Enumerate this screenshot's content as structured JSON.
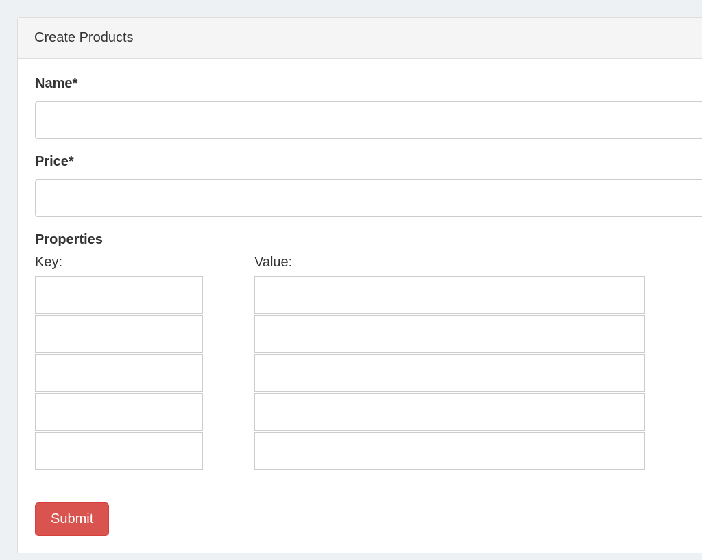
{
  "panel": {
    "title": "Create Products"
  },
  "form": {
    "name_label": "Name*",
    "name_value": "",
    "price_label": "Price*",
    "price_value": "",
    "properties_label": "Properties",
    "key_col_label": "Key:",
    "value_col_label": "Value:",
    "property_rows": [
      {
        "key": "",
        "value": ""
      },
      {
        "key": "",
        "value": ""
      },
      {
        "key": "",
        "value": ""
      },
      {
        "key": "",
        "value": ""
      },
      {
        "key": "",
        "value": ""
      }
    ],
    "submit_label": "Submit"
  }
}
